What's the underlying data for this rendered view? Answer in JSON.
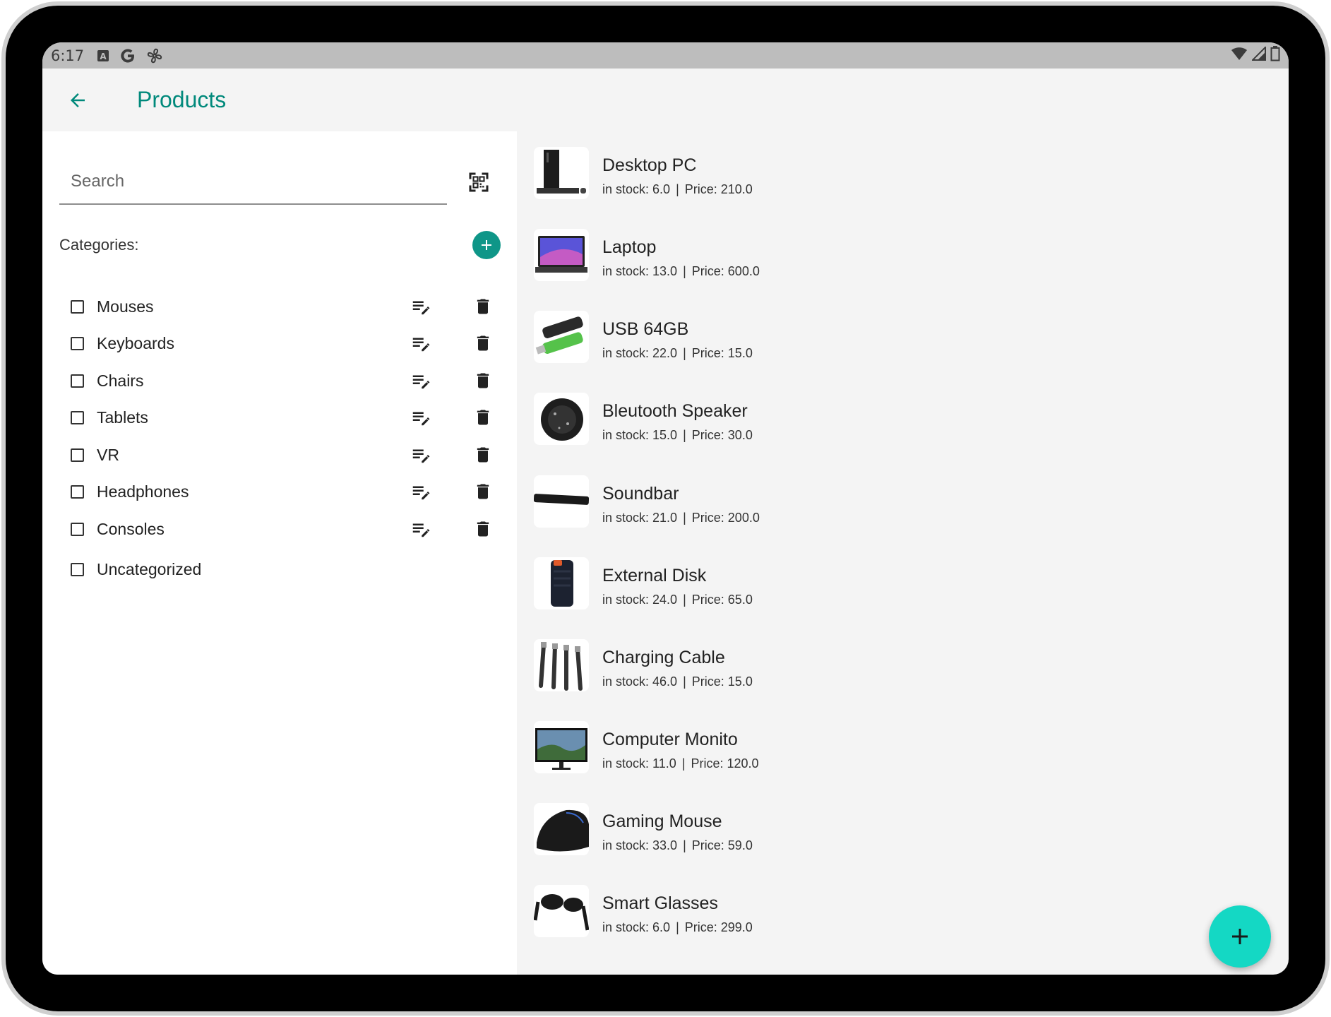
{
  "status_bar": {
    "time": "6:17",
    "left_icons": [
      "notification-a-icon",
      "google-icon",
      "fan-icon"
    ],
    "right_icons": [
      "wifi-icon",
      "signal-icon",
      "battery-icon"
    ]
  },
  "app_bar": {
    "title": "Products",
    "back_icon": "arrow-back-icon",
    "accent_color": "#00897b"
  },
  "search": {
    "placeholder": "Search",
    "value": ""
  },
  "categories": {
    "header": "Categories:",
    "items": [
      {
        "label": "Mouses",
        "checked": false,
        "editable": true
      },
      {
        "label": "Keyboards",
        "checked": false,
        "editable": true
      },
      {
        "label": "Chairs",
        "checked": false,
        "editable": true
      },
      {
        "label": "Tablets",
        "checked": false,
        "editable": true
      },
      {
        "label": "VR",
        "checked": false,
        "editable": true
      },
      {
        "label": "Headphones",
        "checked": false,
        "editable": true
      },
      {
        "label": "Consoles",
        "checked": false,
        "editable": true
      },
      {
        "label": "Uncategorized",
        "checked": false,
        "editable": false
      }
    ]
  },
  "products": [
    {
      "name": "Desktop PC",
      "stock_text": "in stock: 6.0",
      "separator": "|",
      "price_text": "Price: 210.0",
      "image": "desktop-pc-image"
    },
    {
      "name": "Laptop",
      "stock_text": "in stock: 13.0",
      "separator": "|",
      "price_text": "Price: 600.0",
      "image": "laptop-image"
    },
    {
      "name": "USB 64GB",
      "stock_text": "in stock: 22.0",
      "separator": "|",
      "price_text": "Price: 15.0",
      "image": "usb-drive-image"
    },
    {
      "name": "Bleutooth Speaker",
      "stock_text": "in stock: 15.0",
      "separator": "|",
      "price_text": "Price: 30.0",
      "image": "speaker-image"
    },
    {
      "name": "Soundbar",
      "stock_text": "in stock: 21.0",
      "separator": "|",
      "price_text": "Price: 200.0",
      "image": "soundbar-image"
    },
    {
      "name": "External Disk",
      "stock_text": "in stock: 24.0",
      "separator": "|",
      "price_text": "Price: 65.0",
      "image": "external-disk-image"
    },
    {
      "name": "Charging Cable",
      "stock_text": "in stock: 46.0",
      "separator": "|",
      "price_text": "Price: 15.0",
      "image": "charging-cable-image"
    },
    {
      "name": "Computer Monito",
      "stock_text": "in stock: 11.0",
      "separator": "|",
      "price_text": "Price: 120.0",
      "image": "monitor-image"
    },
    {
      "name": "Gaming Mouse",
      "stock_text": "in stock: 33.0",
      "separator": "|",
      "price_text": "Price: 59.0",
      "image": "gaming-mouse-image"
    },
    {
      "name": "Smart Glasses",
      "stock_text": "in stock: 6.0",
      "separator": "|",
      "price_text": "Price: 299.0",
      "image": "smart-glasses-image"
    }
  ],
  "fab": {
    "icon": "plus-icon",
    "color": "#14d8c4"
  }
}
